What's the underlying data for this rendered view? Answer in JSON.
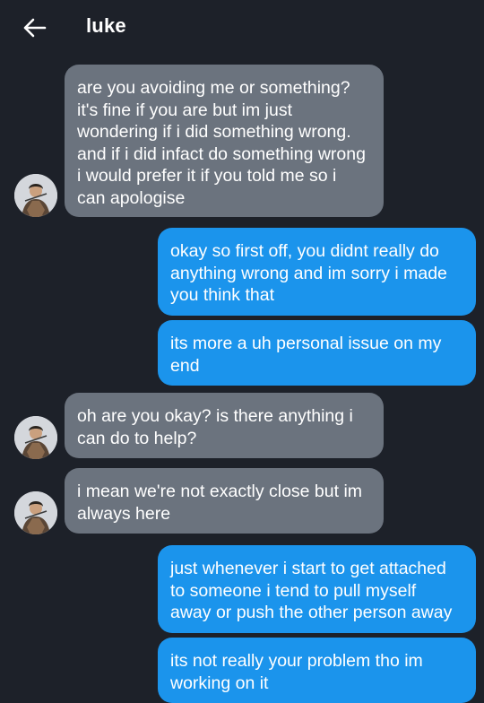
{
  "header": {
    "back_icon": "arrow-left-icon",
    "contact_name": "luke"
  },
  "colors": {
    "background": "#1d2129",
    "incoming_bubble": "#6b737e",
    "outgoing_bubble": "#1b94ec",
    "text": "#ffffff"
  },
  "messages": [
    {
      "sender": "luke",
      "text": "are you avoiding me or something? it's fine if you are but im just wondering if i did something wrong. and if i did infact do something wrong i would prefer it if you told me so i can apologise"
    },
    {
      "sender": "me",
      "text": "okay so first off, you didnt really do anything wrong and im sorry i made you think that"
    },
    {
      "sender": "me",
      "text": "its more a uh personal issue on my end"
    },
    {
      "sender": "luke",
      "text": "oh are you okay? is there anything i can do to help?"
    },
    {
      "sender": "luke",
      "text": "i mean we're not exactly close but im always here"
    },
    {
      "sender": "me",
      "text": "just whenever i start to get attached to someone i tend to pull myself away or push the other person away"
    },
    {
      "sender": "me",
      "text": "its not really your problem tho im working on it"
    }
  ]
}
